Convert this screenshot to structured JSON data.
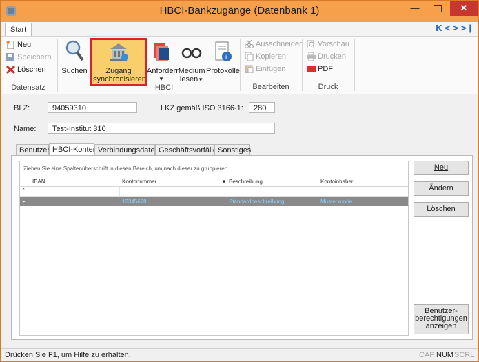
{
  "window": {
    "title": "HBCI-Bankzugänge (Datenbank 1)",
    "minimize_symbol": "—",
    "close_symbol": "✕"
  },
  "ribbon": {
    "tab": "Start",
    "nav_arrows": [
      "K",
      "<",
      ">",
      ">|"
    ],
    "datensatz": {
      "label": "Datensatz",
      "neu": "Neu",
      "speichern": "Speichern",
      "loeschen": "Löschen"
    },
    "suchen": "Suchen",
    "hbci": {
      "label": "HBCI",
      "zugang_line1": "Zugang",
      "zugang_line2": "synchronisieren",
      "anfordern": "Anfordern",
      "medium_line1": "Medium",
      "medium_line2": "lesen",
      "protokolle": "Protokolle"
    },
    "bearbeiten": {
      "label": "Bearbeiten",
      "ausschneiden": "Ausschneiden",
      "kopieren": "Kopieren",
      "einfuegen": "Einfügen"
    },
    "druck": {
      "label": "Druck",
      "vorschau": "Vorschau",
      "drucken": "Drucken",
      "pdf": "PDF"
    }
  },
  "form": {
    "blz_label": "BLZ:",
    "blz_value": "94059310",
    "lkz_label": "LKZ gemäß ISO 3166-1:",
    "lkz_value": "280",
    "name_label": "Name:",
    "name_value": "Test-Institut 310"
  },
  "tabs": [
    "Benutzer",
    "HBCI-Konten",
    "Verbindungsdaten",
    "Geschäftsvorfälle",
    "Sonstiges"
  ],
  "grid": {
    "group_hint": "Ziehen Sie eine Spaltenüberschrift in diesen Bereich, um nach dieser zu gruppieren",
    "columns": [
      "IBAN",
      "Kontonummer",
      "Beschreibung",
      "Kontoinhaber"
    ],
    "new_row_marker": "*",
    "row_marker": "▸",
    "sort_glyph": "▼",
    "rows": [
      {
        "iban": "",
        "kontonummer": "12345678",
        "beschreibung": "Standardbeschreibung",
        "kontoinhaber": "Musterkunde"
      }
    ]
  },
  "buttons": {
    "neu": "Neu",
    "aendern": "Ändern",
    "loeschen": "Löschen",
    "benutzer_line1": "Benutzer-",
    "benutzer_line2": "berechtigungen",
    "benutzer_line3": "anzeigen"
  },
  "statusbar": {
    "text": "Drücken Sie F1, um Hilfe zu erhalten.",
    "indicators": [
      "CAP",
      "NUM",
      "SCRL"
    ]
  },
  "colors": {
    "titlebar": "#f6a04c",
    "highlight_border": "#d9232a",
    "selected_row": "#8a8a8a",
    "selected_row_text": "#8fd0ff"
  }
}
